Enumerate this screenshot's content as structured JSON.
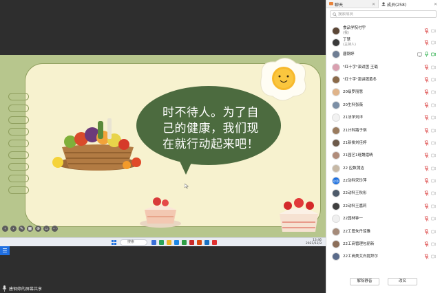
{
  "slide": {
    "slogan": "时不待人。为了自己的健康，我们现在就行动起来吧！"
  },
  "taskbar": {
    "search_label": "搜索",
    "clock_time": "13:46",
    "clock_date": "2021/12/3"
  },
  "share_status": {
    "text": "唐钢婷的屏幕共享"
  },
  "panel": {
    "tabs": [
      {
        "label": "聊天"
      },
      {
        "label": "成员(258)"
      }
    ],
    "search_placeholder": "搜索成员",
    "members": [
      {
        "name": "食品学院付宇",
        "role": "(我)",
        "avatar_color": "#5b4636",
        "mic": "off",
        "cam": "off"
      },
      {
        "name": "丁慧",
        "role": "(主持人)",
        "avatar_color": "#3a3a3a",
        "mic": "off",
        "cam": "off"
      },
      {
        "name": "唐钢婷",
        "role": "",
        "avatar_color": "#6e7d93",
        "mic": "on",
        "cam": "on",
        "sharing": true
      },
      {
        "name": "\"红十字\"演讲团 王璐",
        "role": "",
        "avatar_color": "#d9a0b0",
        "mic": "off",
        "cam": "off"
      },
      {
        "name": "\"红十字\"演讲团黄冬",
        "role": "",
        "avatar_color": "#8a6a4a",
        "mic": "off",
        "cam": "off"
      },
      {
        "name": "20级罗丽慧",
        "role": "",
        "avatar_color": "#e0b48a",
        "mic": "off",
        "cam": "off"
      },
      {
        "name": "20生科张薇",
        "role": "",
        "avatar_color": "#7c8fa6",
        "mic": "off",
        "cam": "off"
      },
      {
        "name": "21法学刘洋",
        "role": "",
        "avatar_color": "#f2f2f2",
        "mic": "off",
        "cam": "off"
      },
      {
        "name": "21计科路子琪",
        "role": "",
        "avatar_color": "#9a7b5e",
        "mic": "off",
        "cam": "off"
      },
      {
        "name": "21新俊刘佳婷",
        "role": "",
        "avatar_color": "#6d5a4a",
        "mic": "off",
        "cam": "off"
      },
      {
        "name": "21园艺1班魏熠晴",
        "role": "",
        "avatar_color": "#b08c7a",
        "mic": "off",
        "cam": "off"
      },
      {
        "name": "22 应数蒲洁",
        "role": "",
        "avatar_color": "#c7b9a6",
        "mic": "off",
        "cam": "off"
      },
      {
        "name": "22动科宋珍萍",
        "role": "",
        "avatar_color": "#1d70e0",
        "avatar_text": "珍萍",
        "mic": "off",
        "cam": "off"
      },
      {
        "name": "22动科王秋彤",
        "role": "",
        "avatar_color": "#4d5a6a",
        "mic": "off",
        "cam": "off"
      },
      {
        "name": "22动科王嘉莉",
        "role": "",
        "avatar_color": "#3f3f3f",
        "mic": "off",
        "cam": "off"
      },
      {
        "name": "22园林钟一",
        "role": "",
        "avatar_color": "#f0f0f0",
        "mic": "off",
        "cam": "off"
      },
      {
        "name": "22工管朱丹琼雅",
        "role": "",
        "avatar_color": "#a58b7a",
        "mic": "off",
        "cam": "off"
      },
      {
        "name": "22工商管理包丽新",
        "role": "",
        "avatar_color": "#8c6f5a",
        "mic": "off",
        "cam": "off"
      },
      {
        "name": "22工商美艾白提拜尔",
        "role": "",
        "avatar_color": "#5a6b8a",
        "mic": "off",
        "cam": "off"
      }
    ],
    "footer": {
      "unmute_all": "解除静音",
      "rename": "改名"
    }
  },
  "colors": {
    "slide_bg": "#b7c68d",
    "slide_paper": "#f7f2cf",
    "bubble": "#4c6b3f",
    "accent_blue": "#1d70e0",
    "mic_off_red": "#e05a5a",
    "mic_on_green": "#3cb55a"
  }
}
